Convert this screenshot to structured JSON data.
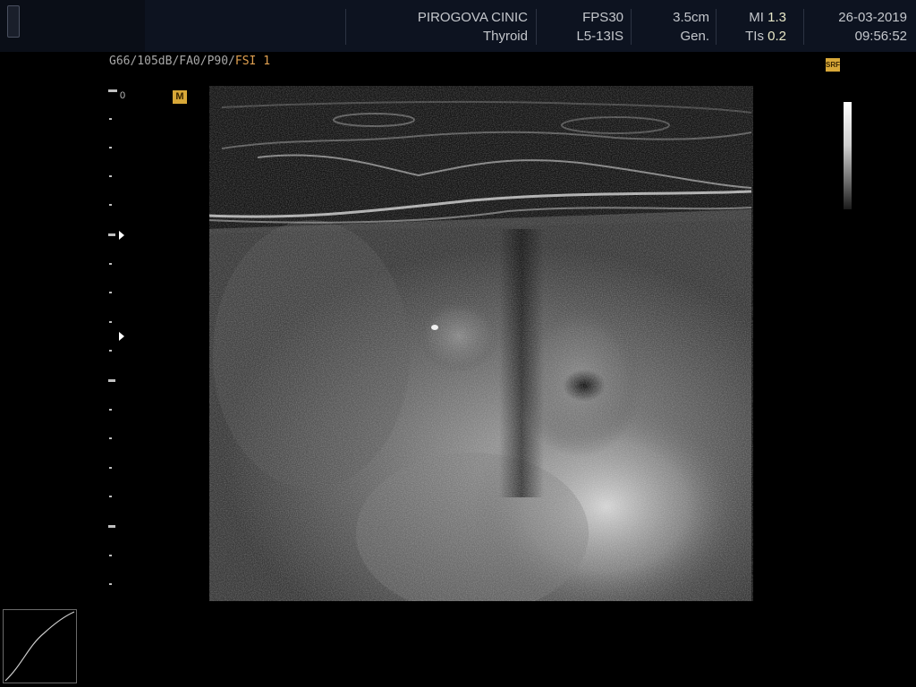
{
  "header": {
    "clinic": "PIROGOVA CINIC",
    "preset": "Thyroid",
    "fps": "FPS30",
    "probe": "L5-13IS",
    "depth": "3.5cm",
    "mode": "Gen.",
    "mi_label": "MI",
    "mi_value": "1.3",
    "tis_label": "TIs",
    "tis_value": "0.2",
    "date": "26-03-2019",
    "time": "09:56:52"
  },
  "params": {
    "prefix": "G66/105dB/FA0/P90/",
    "fsi": "FSI 1"
  },
  "badges": {
    "m": "M",
    "srf": "SRF"
  },
  "scale": {
    "zero": "0"
  },
  "colors": {
    "header_bg": "#0d1320",
    "badge": "#d8a838",
    "fsi_highlight": "#e0a050"
  },
  "icons": {
    "depth_marker": "triangle-right-icon",
    "curve": "gamma-curve-icon"
  }
}
